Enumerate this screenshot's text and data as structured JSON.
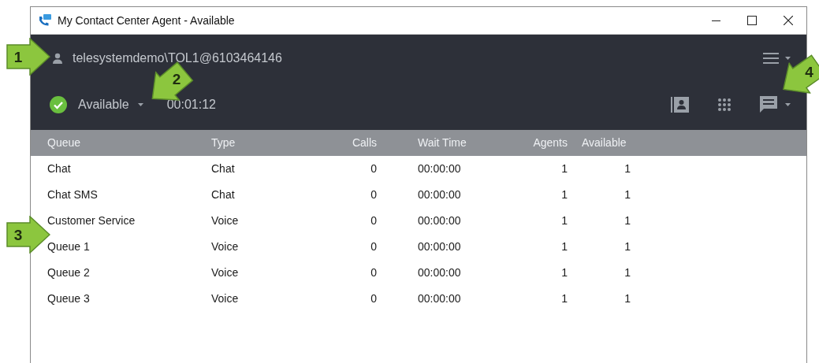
{
  "window": {
    "title": "My Contact Center Agent - Available"
  },
  "user": {
    "name": "telesystemdemo\\TOL1@6103464146"
  },
  "status": {
    "label": "Available",
    "timer": "00:01:12"
  },
  "table": {
    "columns": [
      "Queue",
      "Type",
      "Calls",
      "Wait Time",
      "Agents",
      "Available"
    ],
    "rows": [
      [
        "Chat",
        "Chat",
        "0",
        "00:00:00",
        "1",
        "1"
      ],
      [
        "Chat SMS",
        "Chat",
        "0",
        "00:00:00",
        "1",
        "1"
      ],
      [
        "Customer Service",
        "Voice",
        "0",
        "00:00:00",
        "1",
        "1"
      ],
      [
        "Queue 1",
        "Voice",
        "0",
        "00:00:00",
        "1",
        "1"
      ],
      [
        "Queue 2",
        "Voice",
        "0",
        "00:00:00",
        "1",
        "1"
      ],
      [
        "Queue 3",
        "Voice",
        "0",
        "00:00:00",
        "1",
        "1"
      ]
    ]
  },
  "callouts": [
    {
      "label": "1"
    },
    {
      "label": "2"
    },
    {
      "label": "3"
    },
    {
      "label": "4"
    }
  ]
}
